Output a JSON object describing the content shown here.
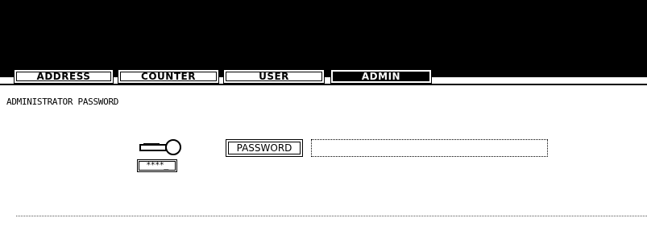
{
  "tabs": [
    {
      "label": "ADDRESS",
      "active": false
    },
    {
      "label": "COUNTER",
      "active": false
    },
    {
      "label": "USER",
      "active": false
    },
    {
      "label": "ADMIN",
      "active": true
    }
  ],
  "screen": {
    "title": "ADMINISTRATOR PASSWORD",
    "masked_placeholder": "****_",
    "password_button_label": "PASSWORD",
    "password_value": ""
  },
  "icons": {
    "key": "key-icon"
  },
  "colors": {
    "topbar": "#000000",
    "background": "#ffffff",
    "active_tab_bg": "#000000",
    "active_tab_text": "#ffffff"
  }
}
